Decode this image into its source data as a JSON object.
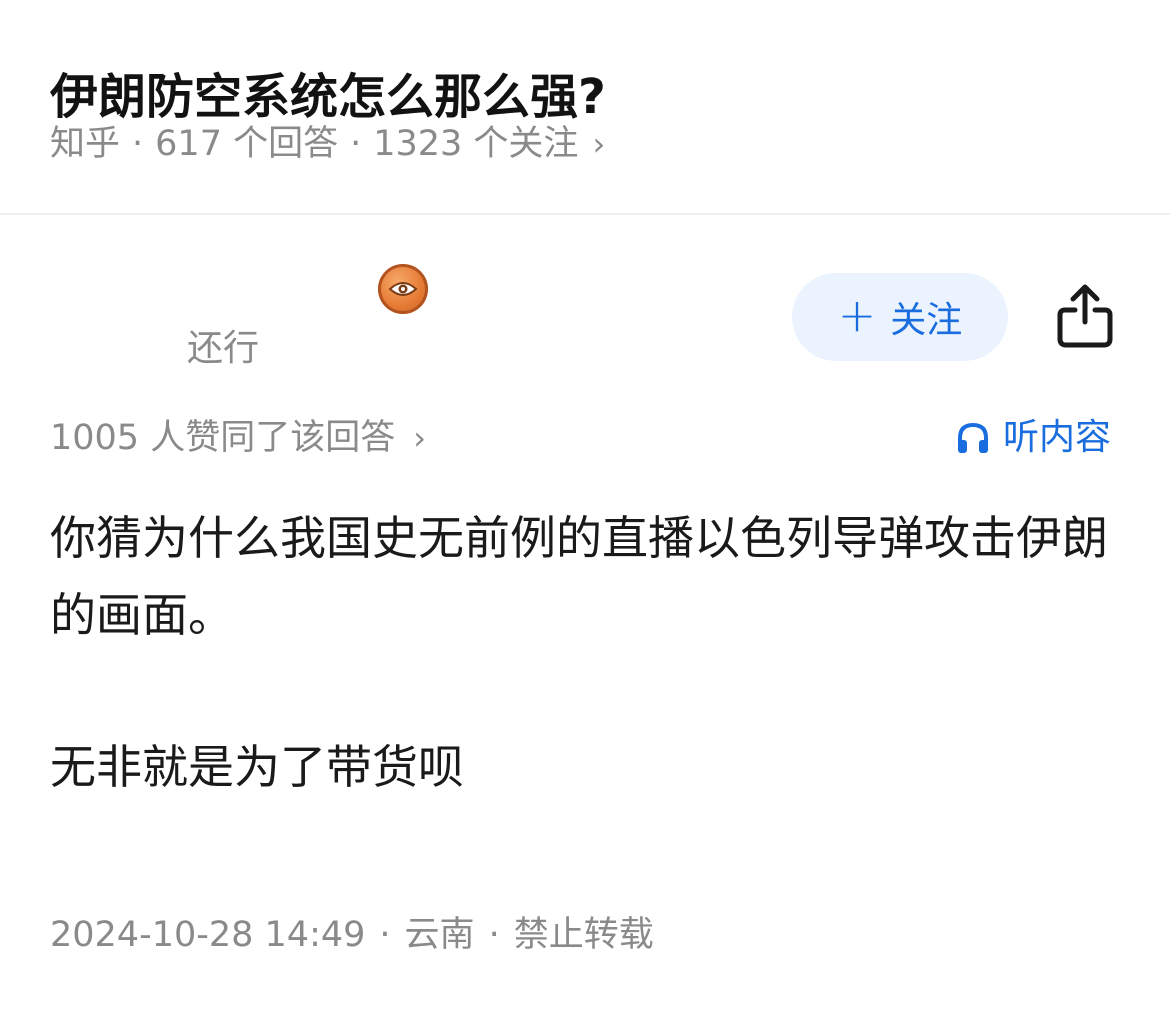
{
  "question": {
    "title": "伊朗防空系统怎么那么强?",
    "source": "知乎",
    "answers_count": "617 个回答",
    "followers_count": "1323 个关注",
    "separator": "·",
    "chevron": "›"
  },
  "author": {
    "badge_icon": "eye-badge-icon",
    "bio": "还行",
    "follow_label": "关注",
    "follow_icon": "plus-icon",
    "share_icon": "share-icon"
  },
  "answer": {
    "upvote_summary": "1005 人赞同了该回答",
    "listen_label": "听内容",
    "listen_icon": "headphones-icon",
    "paragraphs": [
      "你猜为什么我国史无前例的直播以色列导弹攻击伊朗的画面。",
      "无非就是为了带货呗"
    ],
    "footer": {
      "datetime": "2024-10-28 14:49",
      "location": "云南",
      "copyright": "禁止转载"
    }
  },
  "colors": {
    "accent": "#1a6dde",
    "follow_bg": "#ebf3ff",
    "meta_text": "#8a8a8a",
    "badge": "#e57b35"
  }
}
